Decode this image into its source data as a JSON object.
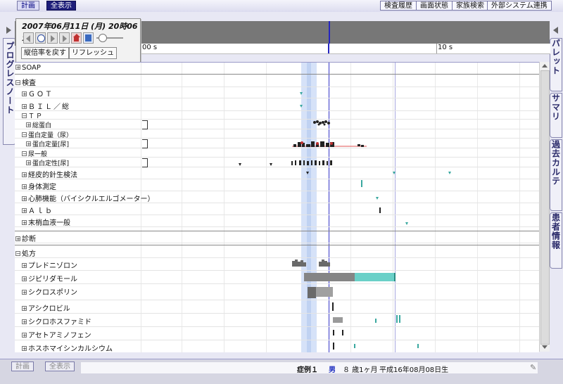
{
  "topbar": {
    "left_buttons": [
      "計画",
      "全表示"
    ],
    "right_buttons": [
      "検査履歴",
      "画面状態",
      "家族検索",
      "外部システム連携"
    ]
  },
  "left_tab": {
    "label": "プログレスノート"
  },
  "right_tabs": [
    "パレット",
    "サマリ",
    "過去カルテ",
    "患者情報"
  ],
  "datetime": "2007年06月11日 (月) 20時06分",
  "controls": {
    "reset_zoom": "縦倍率を戻す",
    "refresh": "リフレッシュ"
  },
  "ruler": {
    "labels": [
      "00 s",
      "10 s"
    ]
  },
  "tree": {
    "soap": "SOAP",
    "kensa": {
      "label": "検査",
      "items": [
        "ＧＯＴ",
        "ＢＩＬ／総",
        "ＴＰ",
        "総蛋白",
        "蛋白定量（尿）",
        "蛋白定量[尿]",
        "尿一般",
        "蛋白定性[尿]",
        "経皮的針生検法",
        "身体測定",
        "心肺機能（バイシクルエルゴメーター）",
        "Ａｌｂ",
        "末梢血液一般"
      ]
    },
    "diagnosis": "診断",
    "prescription": {
      "label": "処方",
      "items": [
        "プレドニゾロン",
        "ジピリダモール",
        "シクロスポリン",
        "アシクロビル",
        "シクロホスファミド",
        "アセトアミノフェン",
        "ホスホマイシンカルシウム"
      ]
    }
  },
  "bottom": {
    "left_buttons": [
      "計画",
      "全表示"
    ],
    "patient": {
      "case": "症例１",
      "sex": "男",
      "age": "８ 歳1ヶ月",
      "birth": "平成16年08月08日生"
    }
  },
  "colors": {
    "accent": "#1e1e7a",
    "timeline_bg": "#777777",
    "cursor": "#2525c0",
    "highlight": "#cfdcf6",
    "teal": "#3aa8a0",
    "gray_bar": "#8a8a8a"
  }
}
